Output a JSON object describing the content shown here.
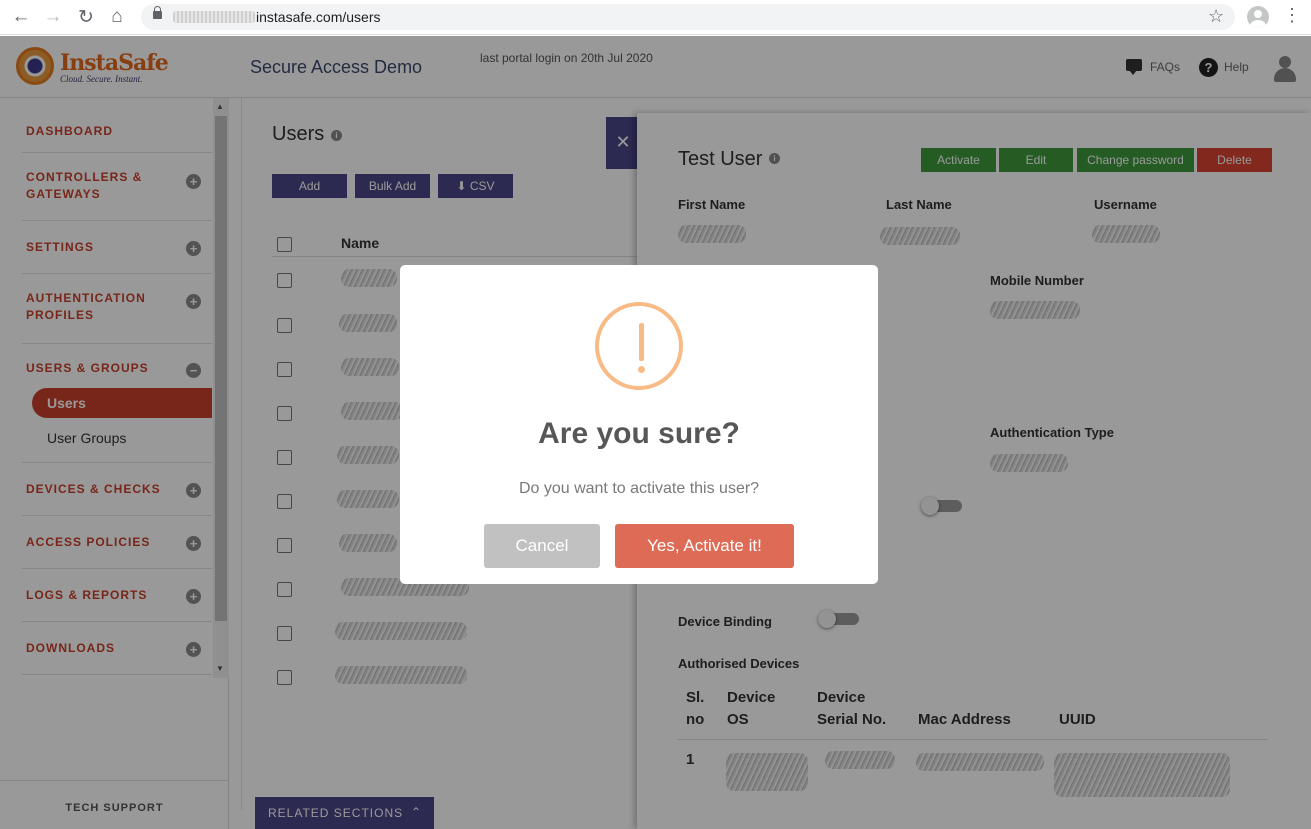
{
  "browser": {
    "url": "instasafe.com/users"
  },
  "header": {
    "logo_text": "InstaSafe",
    "logo_tagline": "Cloud. Secure. Instant.",
    "app_title": "Secure Access Demo",
    "last_login": "last portal login on 20th Jul 2020",
    "faqs": "FAQs",
    "help": "Help"
  },
  "sidebar": {
    "items": [
      {
        "label": "DASHBOARD"
      },
      {
        "label": "CONTROLLERS &\nGATEWAYS"
      },
      {
        "label": "SETTINGS"
      },
      {
        "label": "AUTHENTICATION\nPROFILES"
      },
      {
        "label": "USERS & GROUPS"
      },
      {
        "label": "DEVICES & CHECKS"
      },
      {
        "label": "ACCESS POLICIES"
      },
      {
        "label": "LOGS & REPORTS"
      },
      {
        "label": "DOWNLOADS"
      }
    ],
    "sub_items": [
      "Users",
      "User Groups"
    ],
    "tech_support": "TECH SUPPORT"
  },
  "main": {
    "title": "Users",
    "buttons": {
      "add": "Add",
      "bulk_add": "Bulk Add",
      "csv": "CSV"
    },
    "column_name": "Name",
    "related_sections": "RELATED SECTIONS"
  },
  "panel": {
    "title": "Test User",
    "actions": {
      "activate": "Activate",
      "edit": "Edit",
      "change_password": "Change password",
      "delete": "Delete"
    },
    "fields": {
      "first_name": "First Name",
      "last_name": "Last Name",
      "username": "Username",
      "mobile_number": "Mobile Number",
      "authentication_type": "Authentication Type",
      "device_binding": "Device Binding",
      "authorised_devices": "Authorised Devices"
    },
    "table": {
      "headers": [
        "Sl.\nno",
        "Device\nOS",
        "Device\nSerial No.",
        "Mac Address",
        "UUID"
      ],
      "rows": [
        {
          "sl": "1"
        }
      ]
    }
  },
  "modal": {
    "title": "Are you sure?",
    "text": "Do you want to activate this user?",
    "cancel": "Cancel",
    "confirm": "Yes, Activate it!"
  },
  "colors": {
    "brand_red": "#c9402b",
    "purple": "#4a4785",
    "green": "#3d9a3d",
    "delete_red": "#d9432f",
    "warning": "#f8bb86",
    "confirm": "#dd6b55"
  }
}
